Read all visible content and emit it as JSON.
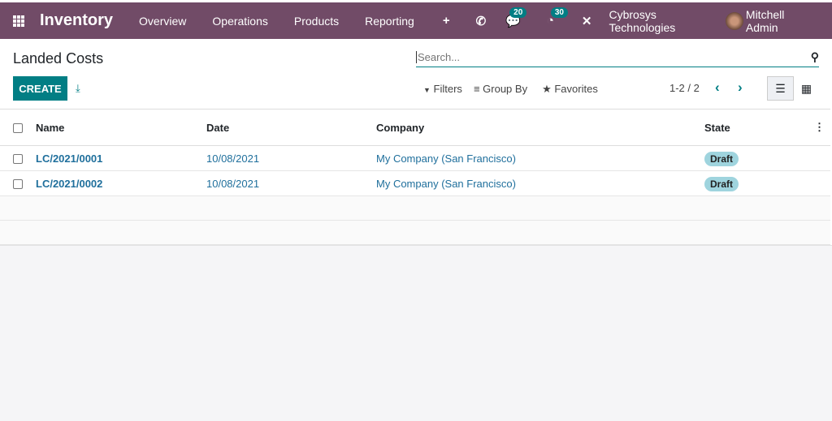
{
  "navbar": {
    "app_title": "Inventory",
    "menu": [
      "Overview",
      "Operations",
      "Products",
      "Reporting"
    ],
    "messages_count": "20",
    "activities_count": "30",
    "company": "Cybrosys Technologies",
    "user": "Mitchell Admin",
    "color": "#714B67"
  },
  "page": {
    "title": "Landed Costs"
  },
  "search": {
    "placeholder": "Search..."
  },
  "toolbar": {
    "create": "CREATE",
    "filters": "Filters",
    "group_by": "Group By",
    "favorites": "Favorites",
    "pager": "1-2 / 2"
  },
  "table": {
    "headers": [
      "Name",
      "Date",
      "Company",
      "State"
    ],
    "rows": [
      {
        "name": "LC/2021/0001",
        "date": "10/08/2021",
        "company": "My Company (San Francisco)",
        "state": "Draft"
      },
      {
        "name": "LC/2021/0002",
        "date": "10/08/2021",
        "company": "My Company (San Francisco)",
        "state": "Draft"
      }
    ]
  },
  "accent": "#017e84"
}
